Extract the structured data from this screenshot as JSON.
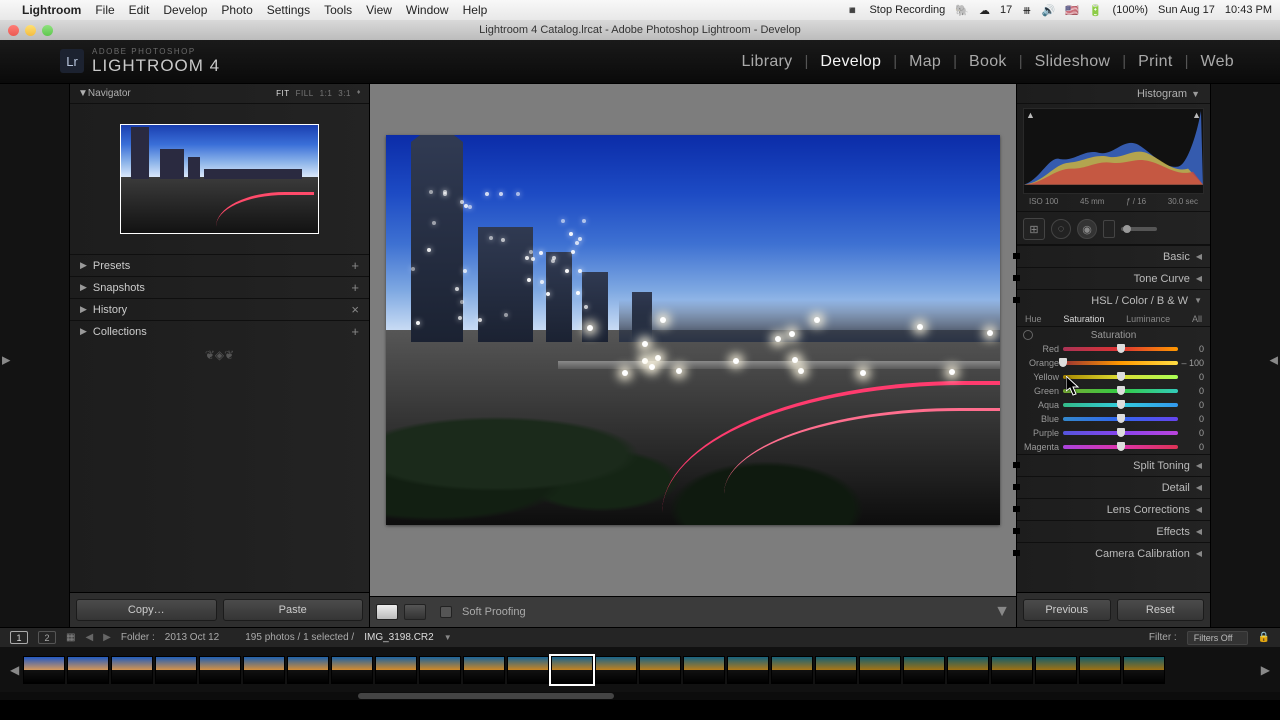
{
  "mac_menu": {
    "app": "Lightroom",
    "items": [
      "File",
      "Edit",
      "Develop",
      "Photo",
      "Settings",
      "Tools",
      "View",
      "Window",
      "Help"
    ],
    "stop_rec": "Stop Recording",
    "battery": "(100%)",
    "date": "Sun Aug 17",
    "time": "10:43 PM",
    "menulet": "17"
  },
  "mac_title": "Lightroom 4 Catalog.lrcat - Adobe Photoshop Lightroom - Develop",
  "brand": {
    "tag": "ADOBE PHOTOSHOP",
    "name": "LIGHTROOM 4",
    "mark": "Lr"
  },
  "modules": [
    "Library",
    "Develop",
    "Map",
    "Book",
    "Slideshow",
    "Print",
    "Web"
  ],
  "active_module": "Develop",
  "navigator": {
    "title": "Navigator",
    "zoom": [
      "FIT",
      "FILL",
      "1:1",
      "3:1"
    ],
    "active": "FIT"
  },
  "left_sections": [
    {
      "label": "Presets",
      "icon": "+"
    },
    {
      "label": "Snapshots",
      "icon": "+"
    },
    {
      "label": "History",
      "icon": "×"
    },
    {
      "label": "Collections",
      "icon": "+"
    }
  ],
  "left_btns": {
    "copy": "Copy…",
    "paste": "Paste"
  },
  "center_bar": {
    "soft": "Soft Proofing"
  },
  "histogram": {
    "title": "Histogram",
    "meta": {
      "iso": "ISO 100",
      "focal": "45 mm",
      "aperture": "ƒ / 16",
      "shutter": "30.0 sec"
    }
  },
  "right_sections": [
    "Basic",
    "Tone Curve"
  ],
  "hsl": {
    "title": "HSL / Color / B & W",
    "tabs": [
      "Hue",
      "Saturation",
      "Luminance",
      "All"
    ],
    "active": "Saturation",
    "subtitle": "Saturation"
  },
  "sliders": [
    {
      "label": "Red",
      "value": 0,
      "pos": 50,
      "grad": [
        "#a35",
        "#d33",
        "#f90"
      ]
    },
    {
      "label": "Orange",
      "value": -100,
      "pos": 0,
      "grad": [
        "#933",
        "#f90",
        "#fd4"
      ]
    },
    {
      "label": "Yellow",
      "value": 0,
      "pos": 50,
      "grad": [
        "#a80",
        "#dd3",
        "#af5"
      ]
    },
    {
      "label": "Green",
      "value": 0,
      "pos": 50,
      "grad": [
        "#7a3",
        "#3c4",
        "#3cb"
      ]
    },
    {
      "label": "Aqua",
      "value": 0,
      "pos": 50,
      "grad": [
        "#3b8",
        "#3cd",
        "#39e"
      ]
    },
    {
      "label": "Blue",
      "value": 0,
      "pos": 50,
      "grad": [
        "#38c",
        "#36e",
        "#64e"
      ]
    },
    {
      "label": "Purple",
      "value": 0,
      "pos": 50,
      "grad": [
        "#55d",
        "#84e",
        "#b4d"
      ]
    },
    {
      "label": "Magenta",
      "value": 0,
      "pos": 50,
      "grad": [
        "#a4d",
        "#d3a",
        "#d35"
      ]
    }
  ],
  "right_extra": [
    "Split Toning",
    "Detail",
    "Lens Corrections",
    "Effects",
    "Camera Calibration"
  ],
  "right_btns": {
    "prev": "Previous",
    "reset": "Reset"
  },
  "lower": {
    "folder_pre": "Folder :",
    "folder": "2013 Oct 12",
    "count": "195 photos / 1 selected /",
    "file": "IMG_3198.CR2",
    "filter_lbl": "Filter :",
    "filter_val": "Filters Off",
    "second_badge": "1",
    "second_badge2": "2"
  },
  "filmstrip": {
    "count": 26,
    "selected": 12
  }
}
